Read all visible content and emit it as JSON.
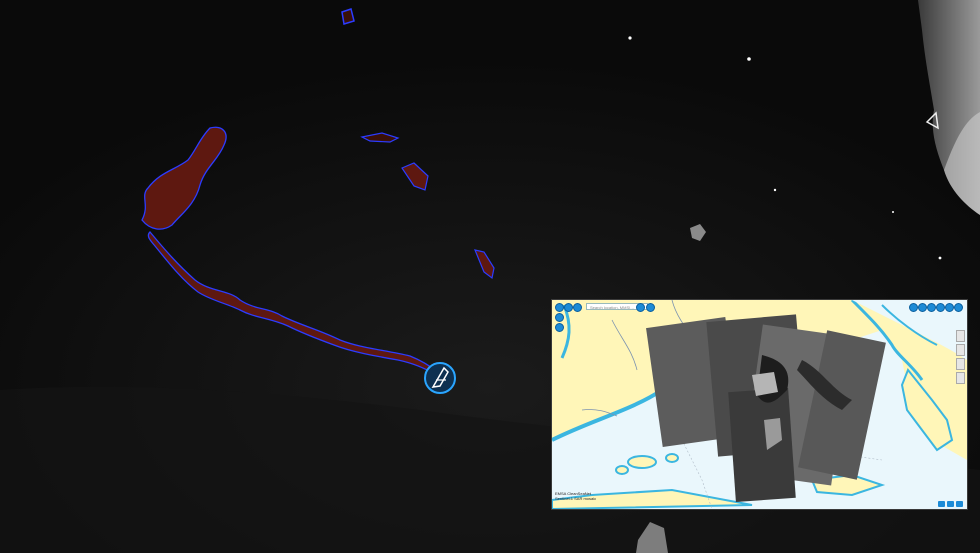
{
  "map": {
    "inset": {
      "search_placeholder": "Search location, MMSI…",
      "caption_line1": "EMSA CleanSeaNet",
      "caption_line2": "Sentinel-1 SAR mosaic"
    }
  },
  "icons": {
    "marker": "vessel-marker-icon",
    "tool_buttons": "map-tool-icons"
  },
  "colors": {
    "sea": "#0b0b0b",
    "slick_fill": "#6e1a10",
    "slick_outline": "#2c3cff",
    "marker_ring": "#2aa5ff",
    "inset_land": "#fff6b8",
    "inset_sea": "#e8f6fc",
    "inset_button": "#1d8bd6"
  }
}
